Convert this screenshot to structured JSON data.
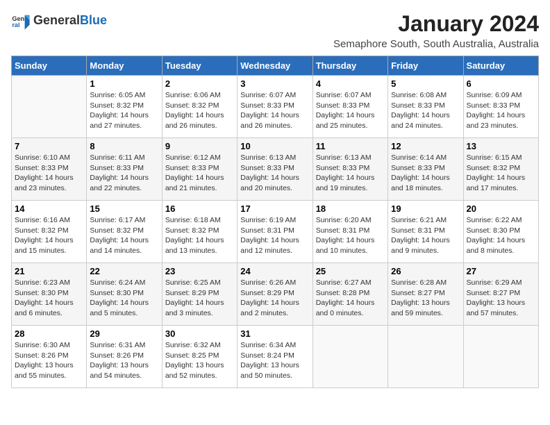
{
  "header": {
    "logo_general": "General",
    "logo_blue": "Blue",
    "title": "January 2024",
    "subtitle": "Semaphore South, South Australia, Australia"
  },
  "days_of_week": [
    "Sunday",
    "Monday",
    "Tuesday",
    "Wednesday",
    "Thursday",
    "Friday",
    "Saturday"
  ],
  "weeks": [
    [
      {
        "day": "",
        "sunrise": "",
        "sunset": "",
        "daylight": ""
      },
      {
        "day": "1",
        "sunrise": "6:05 AM",
        "sunset": "8:32 PM",
        "daylight": "14 hours and 27 minutes."
      },
      {
        "day": "2",
        "sunrise": "6:06 AM",
        "sunset": "8:32 PM",
        "daylight": "14 hours and 26 minutes."
      },
      {
        "day": "3",
        "sunrise": "6:07 AM",
        "sunset": "8:33 PM",
        "daylight": "14 hours and 26 minutes."
      },
      {
        "day": "4",
        "sunrise": "6:07 AM",
        "sunset": "8:33 PM",
        "daylight": "14 hours and 25 minutes."
      },
      {
        "day": "5",
        "sunrise": "6:08 AM",
        "sunset": "8:33 PM",
        "daylight": "14 hours and 24 minutes."
      },
      {
        "day": "6",
        "sunrise": "6:09 AM",
        "sunset": "8:33 PM",
        "daylight": "14 hours and 23 minutes."
      }
    ],
    [
      {
        "day": "7",
        "sunrise": "6:10 AM",
        "sunset": "8:33 PM",
        "daylight": "14 hours and 23 minutes."
      },
      {
        "day": "8",
        "sunrise": "6:11 AM",
        "sunset": "8:33 PM",
        "daylight": "14 hours and 22 minutes."
      },
      {
        "day": "9",
        "sunrise": "6:12 AM",
        "sunset": "8:33 PM",
        "daylight": "14 hours and 21 minutes."
      },
      {
        "day": "10",
        "sunrise": "6:13 AM",
        "sunset": "8:33 PM",
        "daylight": "14 hours and 20 minutes."
      },
      {
        "day": "11",
        "sunrise": "6:13 AM",
        "sunset": "8:33 PM",
        "daylight": "14 hours and 19 minutes."
      },
      {
        "day": "12",
        "sunrise": "6:14 AM",
        "sunset": "8:33 PM",
        "daylight": "14 hours and 18 minutes."
      },
      {
        "day": "13",
        "sunrise": "6:15 AM",
        "sunset": "8:32 PM",
        "daylight": "14 hours and 17 minutes."
      }
    ],
    [
      {
        "day": "14",
        "sunrise": "6:16 AM",
        "sunset": "8:32 PM",
        "daylight": "14 hours and 15 minutes."
      },
      {
        "day": "15",
        "sunrise": "6:17 AM",
        "sunset": "8:32 PM",
        "daylight": "14 hours and 14 minutes."
      },
      {
        "day": "16",
        "sunrise": "6:18 AM",
        "sunset": "8:32 PM",
        "daylight": "14 hours and 13 minutes."
      },
      {
        "day": "17",
        "sunrise": "6:19 AM",
        "sunset": "8:31 PM",
        "daylight": "14 hours and 12 minutes."
      },
      {
        "day": "18",
        "sunrise": "6:20 AM",
        "sunset": "8:31 PM",
        "daylight": "14 hours and 10 minutes."
      },
      {
        "day": "19",
        "sunrise": "6:21 AM",
        "sunset": "8:31 PM",
        "daylight": "14 hours and 9 minutes."
      },
      {
        "day": "20",
        "sunrise": "6:22 AM",
        "sunset": "8:30 PM",
        "daylight": "14 hours and 8 minutes."
      }
    ],
    [
      {
        "day": "21",
        "sunrise": "6:23 AM",
        "sunset": "8:30 PM",
        "daylight": "14 hours and 6 minutes."
      },
      {
        "day": "22",
        "sunrise": "6:24 AM",
        "sunset": "8:30 PM",
        "daylight": "14 hours and 5 minutes."
      },
      {
        "day": "23",
        "sunrise": "6:25 AM",
        "sunset": "8:29 PM",
        "daylight": "14 hours and 3 minutes."
      },
      {
        "day": "24",
        "sunrise": "6:26 AM",
        "sunset": "8:29 PM",
        "daylight": "14 hours and 2 minutes."
      },
      {
        "day": "25",
        "sunrise": "6:27 AM",
        "sunset": "8:28 PM",
        "daylight": "14 hours and 0 minutes."
      },
      {
        "day": "26",
        "sunrise": "6:28 AM",
        "sunset": "8:27 PM",
        "daylight": "13 hours and 59 minutes."
      },
      {
        "day": "27",
        "sunrise": "6:29 AM",
        "sunset": "8:27 PM",
        "daylight": "13 hours and 57 minutes."
      }
    ],
    [
      {
        "day": "28",
        "sunrise": "6:30 AM",
        "sunset": "8:26 PM",
        "daylight": "13 hours and 55 minutes."
      },
      {
        "day": "29",
        "sunrise": "6:31 AM",
        "sunset": "8:26 PM",
        "daylight": "13 hours and 54 minutes."
      },
      {
        "day": "30",
        "sunrise": "6:32 AM",
        "sunset": "8:25 PM",
        "daylight": "13 hours and 52 minutes."
      },
      {
        "day": "31",
        "sunrise": "6:34 AM",
        "sunset": "8:24 PM",
        "daylight": "13 hours and 50 minutes."
      },
      {
        "day": "",
        "sunrise": "",
        "sunset": "",
        "daylight": ""
      },
      {
        "day": "",
        "sunrise": "",
        "sunset": "",
        "daylight": ""
      },
      {
        "day": "",
        "sunrise": "",
        "sunset": "",
        "daylight": ""
      }
    ]
  ]
}
